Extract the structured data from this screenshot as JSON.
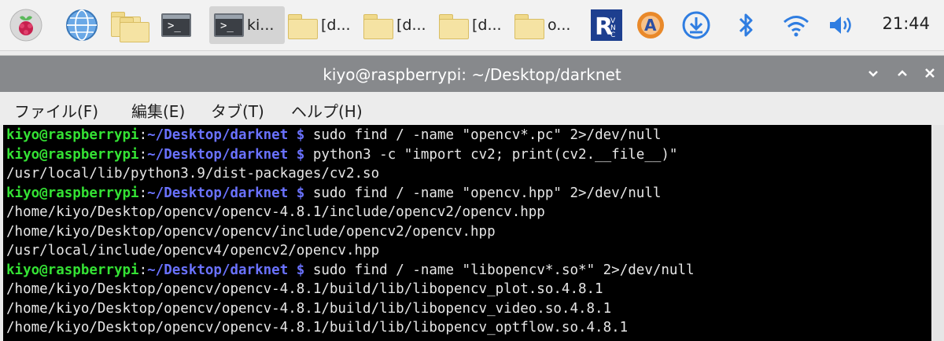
{
  "taskbar": {
    "tasks": [
      {
        "label": "ki..."
      },
      {
        "label": "[d..."
      },
      {
        "label": "[d..."
      },
      {
        "label": "[d..."
      },
      {
        "label": "o..."
      }
    ],
    "clock": "21:44"
  },
  "window": {
    "title": "kiyo@raspberrypi: ~/Desktop/darknet",
    "menu": [
      "ファイル(F)",
      "編集(E)",
      "タブ(T)",
      "ヘルプ(H)"
    ]
  },
  "terminal": {
    "prompt": {
      "user": "kiyo@raspberrypi",
      "sep": ":",
      "path": "~/Desktop/darknet",
      "symbol": "$"
    },
    "lines": [
      {
        "type": "cmd",
        "text": "sudo find / -name \"opencv*.pc\" 2>/dev/null"
      },
      {
        "type": "cmd",
        "text": "python3 -c \"import cv2; print(cv2.__file__)\""
      },
      {
        "type": "out",
        "text": "/usr/local/lib/python3.9/dist-packages/cv2.so"
      },
      {
        "type": "cmd",
        "text": "sudo find / -name \"opencv.hpp\" 2>/dev/null"
      },
      {
        "type": "out",
        "text": "/home/kiyo/Desktop/opencv/opencv-4.8.1/include/opencv2/opencv.hpp"
      },
      {
        "type": "out",
        "text": "/home/kiyo/Desktop/opencv/opencv/include/opencv2/opencv.hpp"
      },
      {
        "type": "out",
        "text": "/usr/local/include/opencv4/opencv2/opencv.hpp"
      },
      {
        "type": "cmd",
        "text": "sudo find / -name \"libopencv*.so*\" 2>/dev/null"
      },
      {
        "type": "out",
        "text": "/home/kiyo/Desktop/opencv/opencv-4.8.1/build/lib/libopencv_plot.so.4.8.1"
      },
      {
        "type": "out",
        "text": "/home/kiyo/Desktop/opencv/opencv-4.8.1/build/lib/libopencv_video.so.4.8.1"
      },
      {
        "type": "out",
        "text": "/home/kiyo/Desktop/opencv/opencv-4.8.1/build/lib/libopencv_optflow.so.4.8.1"
      }
    ]
  },
  "colors": {
    "prompt_user": "#34e234",
    "prompt_path": "#6a72ff",
    "terminal_bg": "#000000",
    "titlebar": "#87898c"
  },
  "icons": [
    "raspberry-menu-icon",
    "web-browser-icon",
    "file-manager-icon",
    "terminal-icon",
    "vnc-icon",
    "updater-icon",
    "download-icon",
    "bluetooth-icon",
    "wifi-icon",
    "volume-icon"
  ]
}
